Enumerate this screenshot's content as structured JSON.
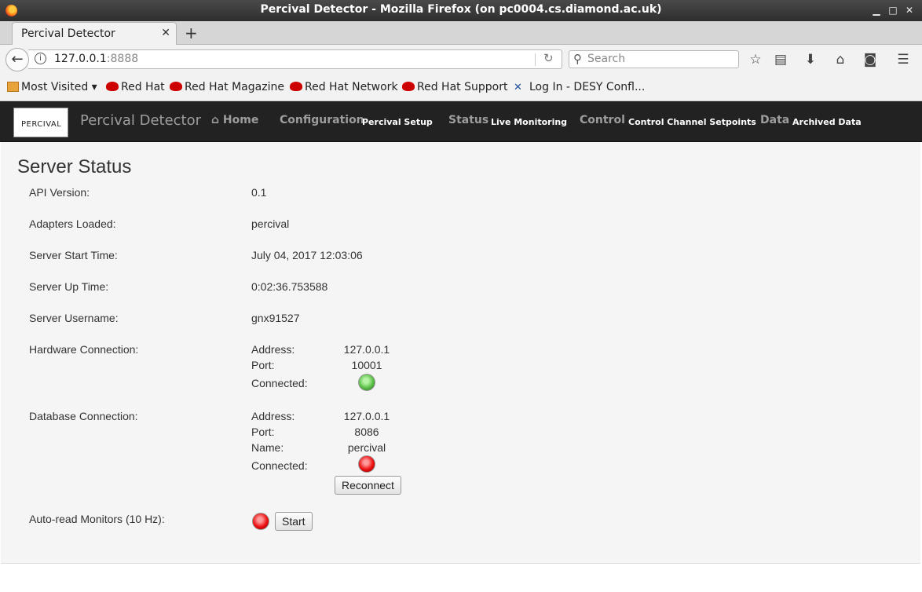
{
  "window": {
    "title": "Percival Detector - Mozilla Firefox (on pc0004.cs.diamond.ac.uk)",
    "minimize": "▁",
    "maximize": "□",
    "close": "✕"
  },
  "tabs": [
    {
      "label": "Percival Detector",
      "close": "✕"
    }
  ],
  "newtab": "+",
  "navbar": {
    "back": "←",
    "url_host": "127.0.0.1",
    "url_port": ":8888",
    "reload": "↻",
    "search_placeholder": "Search"
  },
  "toolbar_icons": [
    "star-icon",
    "reading-list-icon",
    "download-icon",
    "home-icon",
    "pocket-icon",
    "menu-icon"
  ],
  "bookmarks": [
    {
      "label": "Most Visited ▾",
      "icon": "folder-icon"
    },
    {
      "label": "Red Hat",
      "icon": "redhat-icon"
    },
    {
      "label": "Red Hat Magazine",
      "icon": "redhat-icon"
    },
    {
      "label": "Red Hat Network",
      "icon": "redhat-icon"
    },
    {
      "label": "Red Hat Support",
      "icon": "redhat-icon"
    },
    {
      "label": "Log In - DESY Confl...",
      "icon": "desy-icon"
    }
  ],
  "app": {
    "logo_text": "PERCIVAL",
    "brand": "Percival Detector",
    "nav": [
      {
        "label": "Home",
        "sub": ""
      },
      {
        "label": "Configuration",
        "sub": "Percival Setup"
      },
      {
        "label": "Status",
        "sub": "Live Monitoring"
      },
      {
        "label": "Control",
        "sub": "Control Channel Setpoints"
      },
      {
        "label": "Data",
        "sub": "Archived Data"
      }
    ]
  },
  "status": {
    "title": "Server Status",
    "api_version_label": "API Version:",
    "api_version": "0.1",
    "adapters_label": "Adapters Loaded:",
    "adapters": "percival",
    "start_time_label": "Server Start Time:",
    "start_time": "July 04, 2017 12:03:06",
    "up_time_label": "Server Up Time:",
    "up_time": "0:02:36.753588",
    "username_label": "Server Username:",
    "username": "gnx91527",
    "hardware": {
      "label": "Hardware Connection:",
      "address_label": "Address:",
      "address": "127.0.0.1",
      "port_label": "Port:",
      "port": "10001",
      "connected_label": "Connected:",
      "connected": true
    },
    "database": {
      "label": "Database Connection:",
      "address_label": "Address:",
      "address": "127.0.0.1",
      "port_label": "Port:",
      "port": "8086",
      "name_label": "Name:",
      "name": "percival",
      "connected_label": "Connected:",
      "connected": false,
      "reconnect": "Reconnect"
    },
    "autoread": {
      "label": "Auto-read Monitors (10 Hz):",
      "active": false,
      "start": "Start"
    }
  }
}
